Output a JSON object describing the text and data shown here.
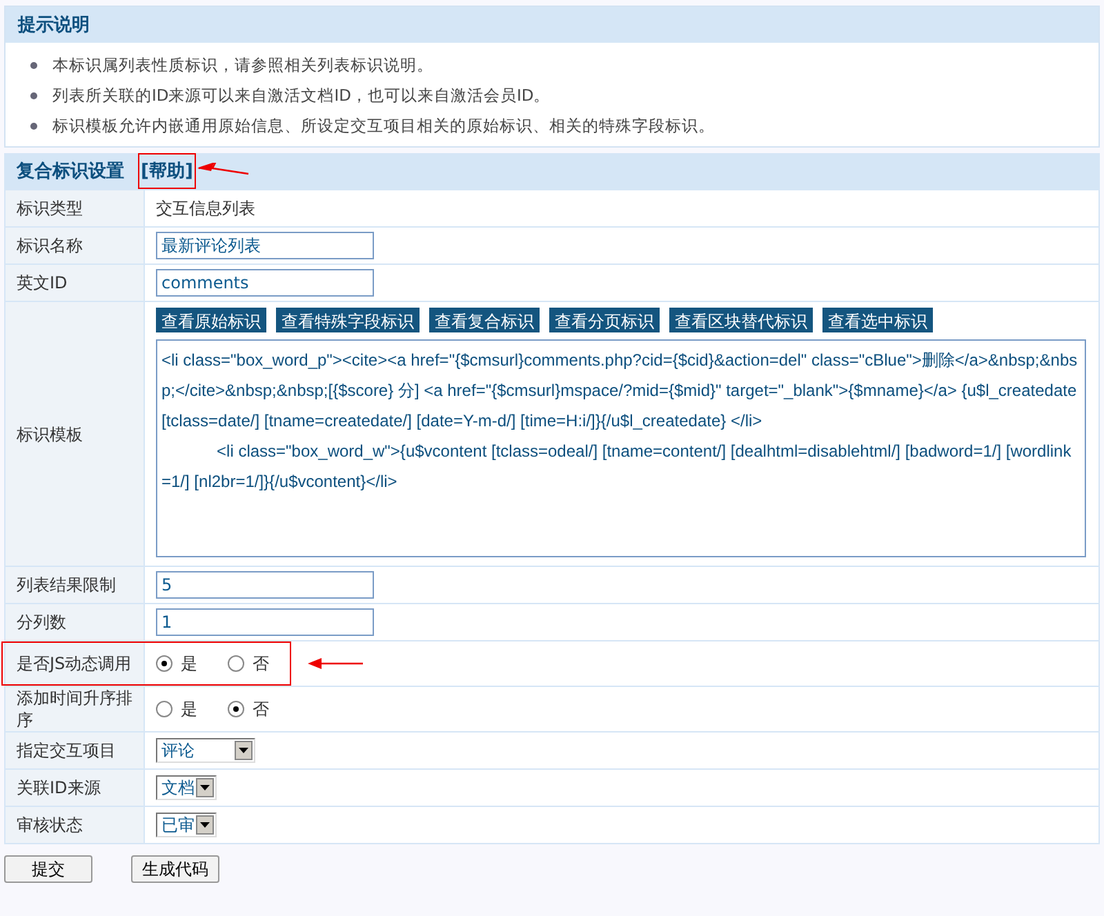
{
  "notice": {
    "title": "提示说明",
    "items": [
      "本标识属列表性质标识，请参照相关列表标识说明。",
      "列表所关联的ID来源可以来自激活文档ID，也可以来自激活会员ID。",
      "标识模板允许内嵌通用原始信息、所设定交互项目相关的原始标识、相关的特殊字段标识。"
    ]
  },
  "settings": {
    "title": "复合标识设置",
    "help_link": {
      "label": "[帮助]",
      "annotated": true
    },
    "rows": [
      {
        "kind": "text",
        "label": "标识类型",
        "value": "交互信息列表"
      },
      {
        "kind": "input",
        "label": "标识名称",
        "value": "最新评论列表"
      },
      {
        "kind": "input",
        "label": "英文ID",
        "value": "comments"
      },
      {
        "kind": "template",
        "label": "标识模板",
        "buttons": [
          "查看原始标识",
          "查看特殊字段标识",
          "查看复合标识",
          "查看分页标识",
          "查看区块替代标识",
          "查看选中标识"
        ],
        "value": "<li class=\"box_word_p\"><cite><a href=\"{$cmsurl}comments.php?cid={$cid}&action=del\" class=\"cBlue\">删除</a>&nbsp;&nbsp;</cite>&nbsp;&nbsp;[{$score} 分] <a href=\"{$cmsurl}mspace/?mid={$mid}\" target=\"_blank\">{$mname}</a> {u$l_createdate [tclass=date/] [tname=createdate/] [date=Y-m-d/] [time=H:i/]}{/u$l_createdate} </li>\n            <li class=\"box_word_w\">{u$vcontent [tclass=odeal/] [tname=content/] [dealhtml=disablehtml/] [badword=1/] [wordlink=1/] [nl2br=1/]}{/u$vcontent}</li>"
      },
      {
        "kind": "input",
        "label": "列表结果限制",
        "value": "5"
      },
      {
        "kind": "input",
        "label": "分列数",
        "value": "1"
      },
      {
        "kind": "radio",
        "label": "是否JS动态调用",
        "annotated": true,
        "options": [
          {
            "label": "是",
            "selected": true
          },
          {
            "label": "否",
            "selected": false
          }
        ]
      },
      {
        "kind": "radio",
        "label": "添加时间升序排序",
        "annotated": false,
        "options": [
          {
            "label": "是",
            "selected": false
          },
          {
            "label": "否",
            "selected": true
          }
        ]
      },
      {
        "kind": "select",
        "label": "指定交互项目",
        "value": "评论",
        "wide": true
      },
      {
        "kind": "select",
        "label": "关联ID来源",
        "value": "文档",
        "wide": false
      },
      {
        "kind": "select",
        "label": "审核状态",
        "value": "已审",
        "wide": false
      }
    ]
  },
  "buttons": [
    "提交",
    "生成代码"
  ]
}
